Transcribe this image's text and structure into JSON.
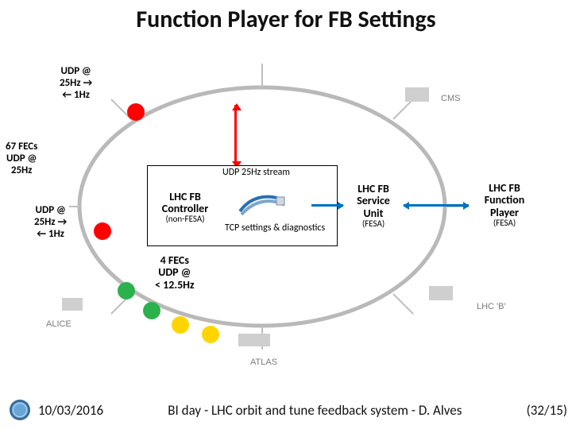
{
  "title": "Function Player for FB Settings",
  "labels": {
    "udp_top": "UDP @\n25Hz →\n← 1Hz",
    "udp_mid": "UDP @\n25Hz →\n← 1Hz",
    "fecs67": "67 FECs\nUDP @\n25Hz",
    "fecs4": "4 FECs\nUDP @\n< 12.5Hz",
    "stream_udp": "UDP 25Hz stream",
    "tcp": "TCP settings &\ndiagnostics"
  },
  "boxes": {
    "controller": {
      "l1": "LHC FB",
      "l2": "Controller",
      "sub": "(non-FESA)"
    },
    "service": {
      "l1": "LHC FB",
      "l2": "Service",
      "l3": "Unit",
      "sub": "(FESA)"
    },
    "player": {
      "l1": "LHC FB",
      "l2": "Function",
      "l3": "Player",
      "sub": "(FESA)"
    }
  },
  "experiments": {
    "cms": "CMS",
    "lhcb": "LHC 'B'",
    "atlas": "ATLAS",
    "alice": "ALICE"
  },
  "footer": {
    "date": "10/03/2016",
    "talk": "BI day - LHC orbit and tune feedback system - D. Alves",
    "page": "(32/15)"
  }
}
